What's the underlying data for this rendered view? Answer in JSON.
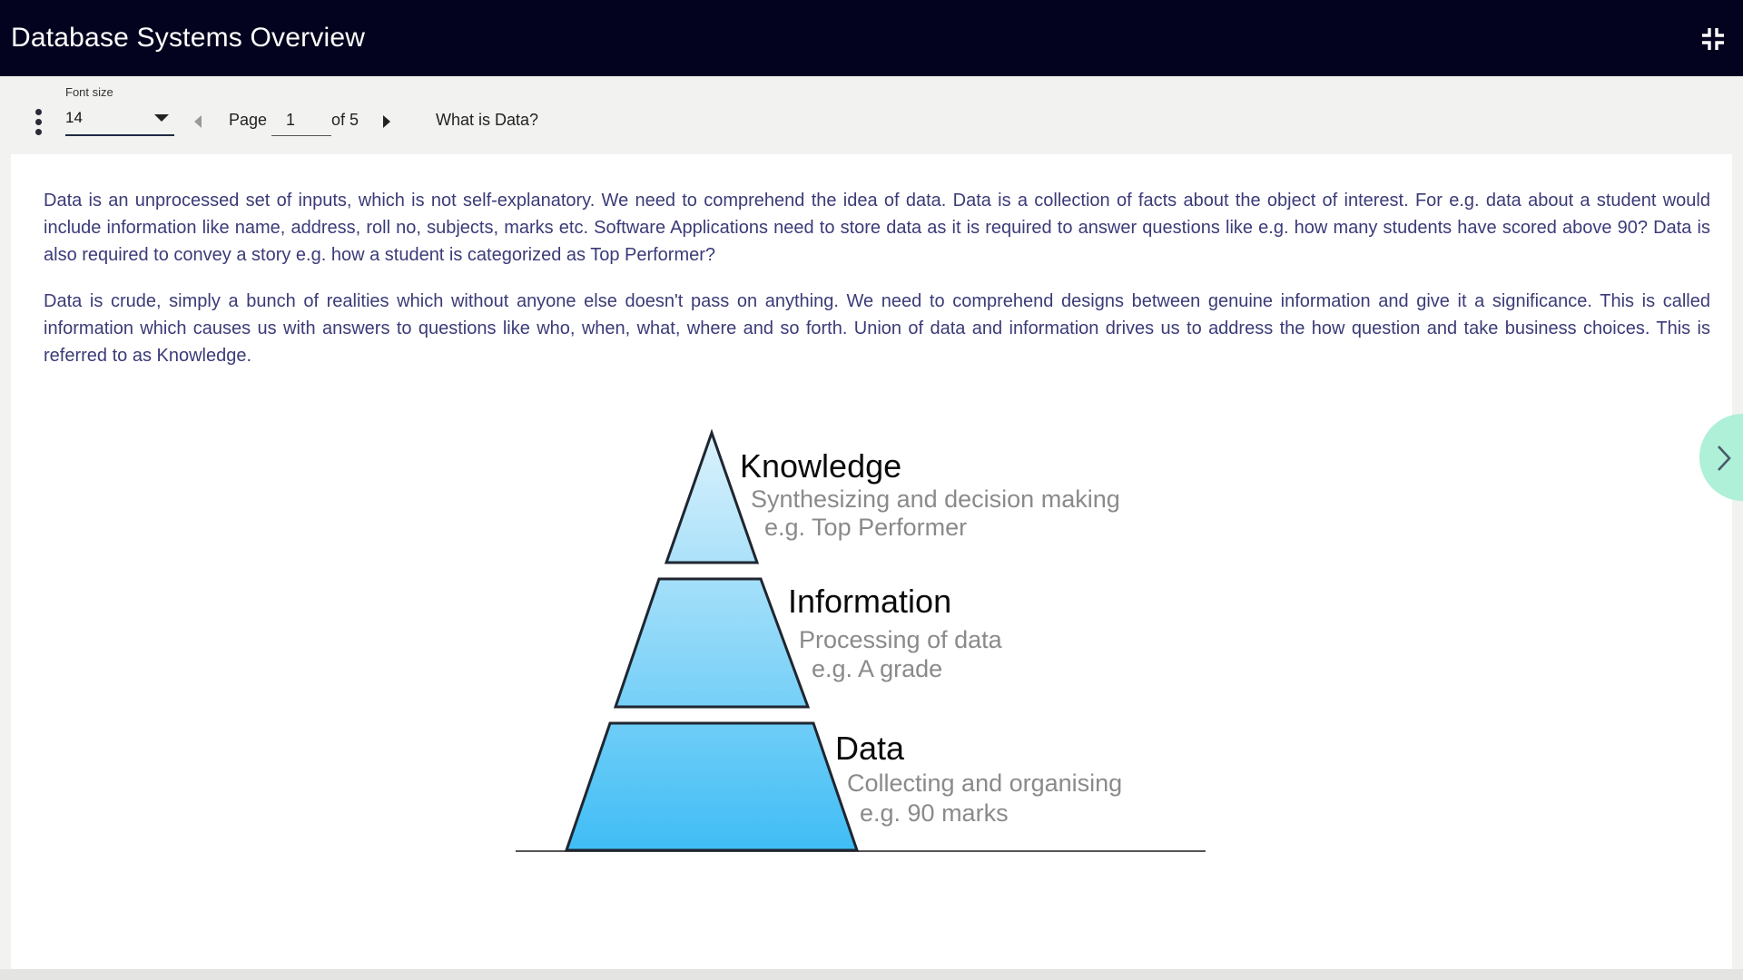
{
  "header": {
    "title": "Database Systems Overview",
    "collapse_icon": "fullscreen-exit-icon"
  },
  "toolbar": {
    "font_size_label": "Font size",
    "font_size_value": "14",
    "page_label": "Page",
    "page_value": "1",
    "page_total": "of 5",
    "section_title": "What is Data?"
  },
  "content": {
    "paragraphs": [
      "Data is an unprocessed set of inputs, which is not self-explanatory. We need to comprehend the idea of data. Data is a collection of facts about the object of interest. For e.g. data about a student would include information like name, address, roll no, subjects, marks etc. Software Applications need to store data as it is required to answer questions like e.g. how many students have scored above 90? Data is also required to convey a story e.g. how a student is categorized as Top Performer?",
      "Data is crude, simply a bunch of realities which without anyone else doesn't pass on anything. We need to comprehend designs between genuine information and give it a significance. This is called information which causes us with answers to questions like who, when, what, where and so forth. Union of data and information drives us to address the how question and take business choices. This is referred to as Knowledge."
    ],
    "pyramid": {
      "tiers": [
        {
          "title": "Knowledge",
          "line1": "Synthesizing and decision making",
          "line2": "e.g. Top Performer"
        },
        {
          "title": "Information",
          "line1": "Processing of data",
          "line2": "e.g. A grade"
        },
        {
          "title": "Data",
          "line1": "Collecting and organising",
          "line2": "e.g. 90 marks"
        }
      ]
    }
  },
  "colors": {
    "header_bg": "#03031f",
    "body_text": "#3b3b78",
    "next_button": "#aef0d8"
  }
}
